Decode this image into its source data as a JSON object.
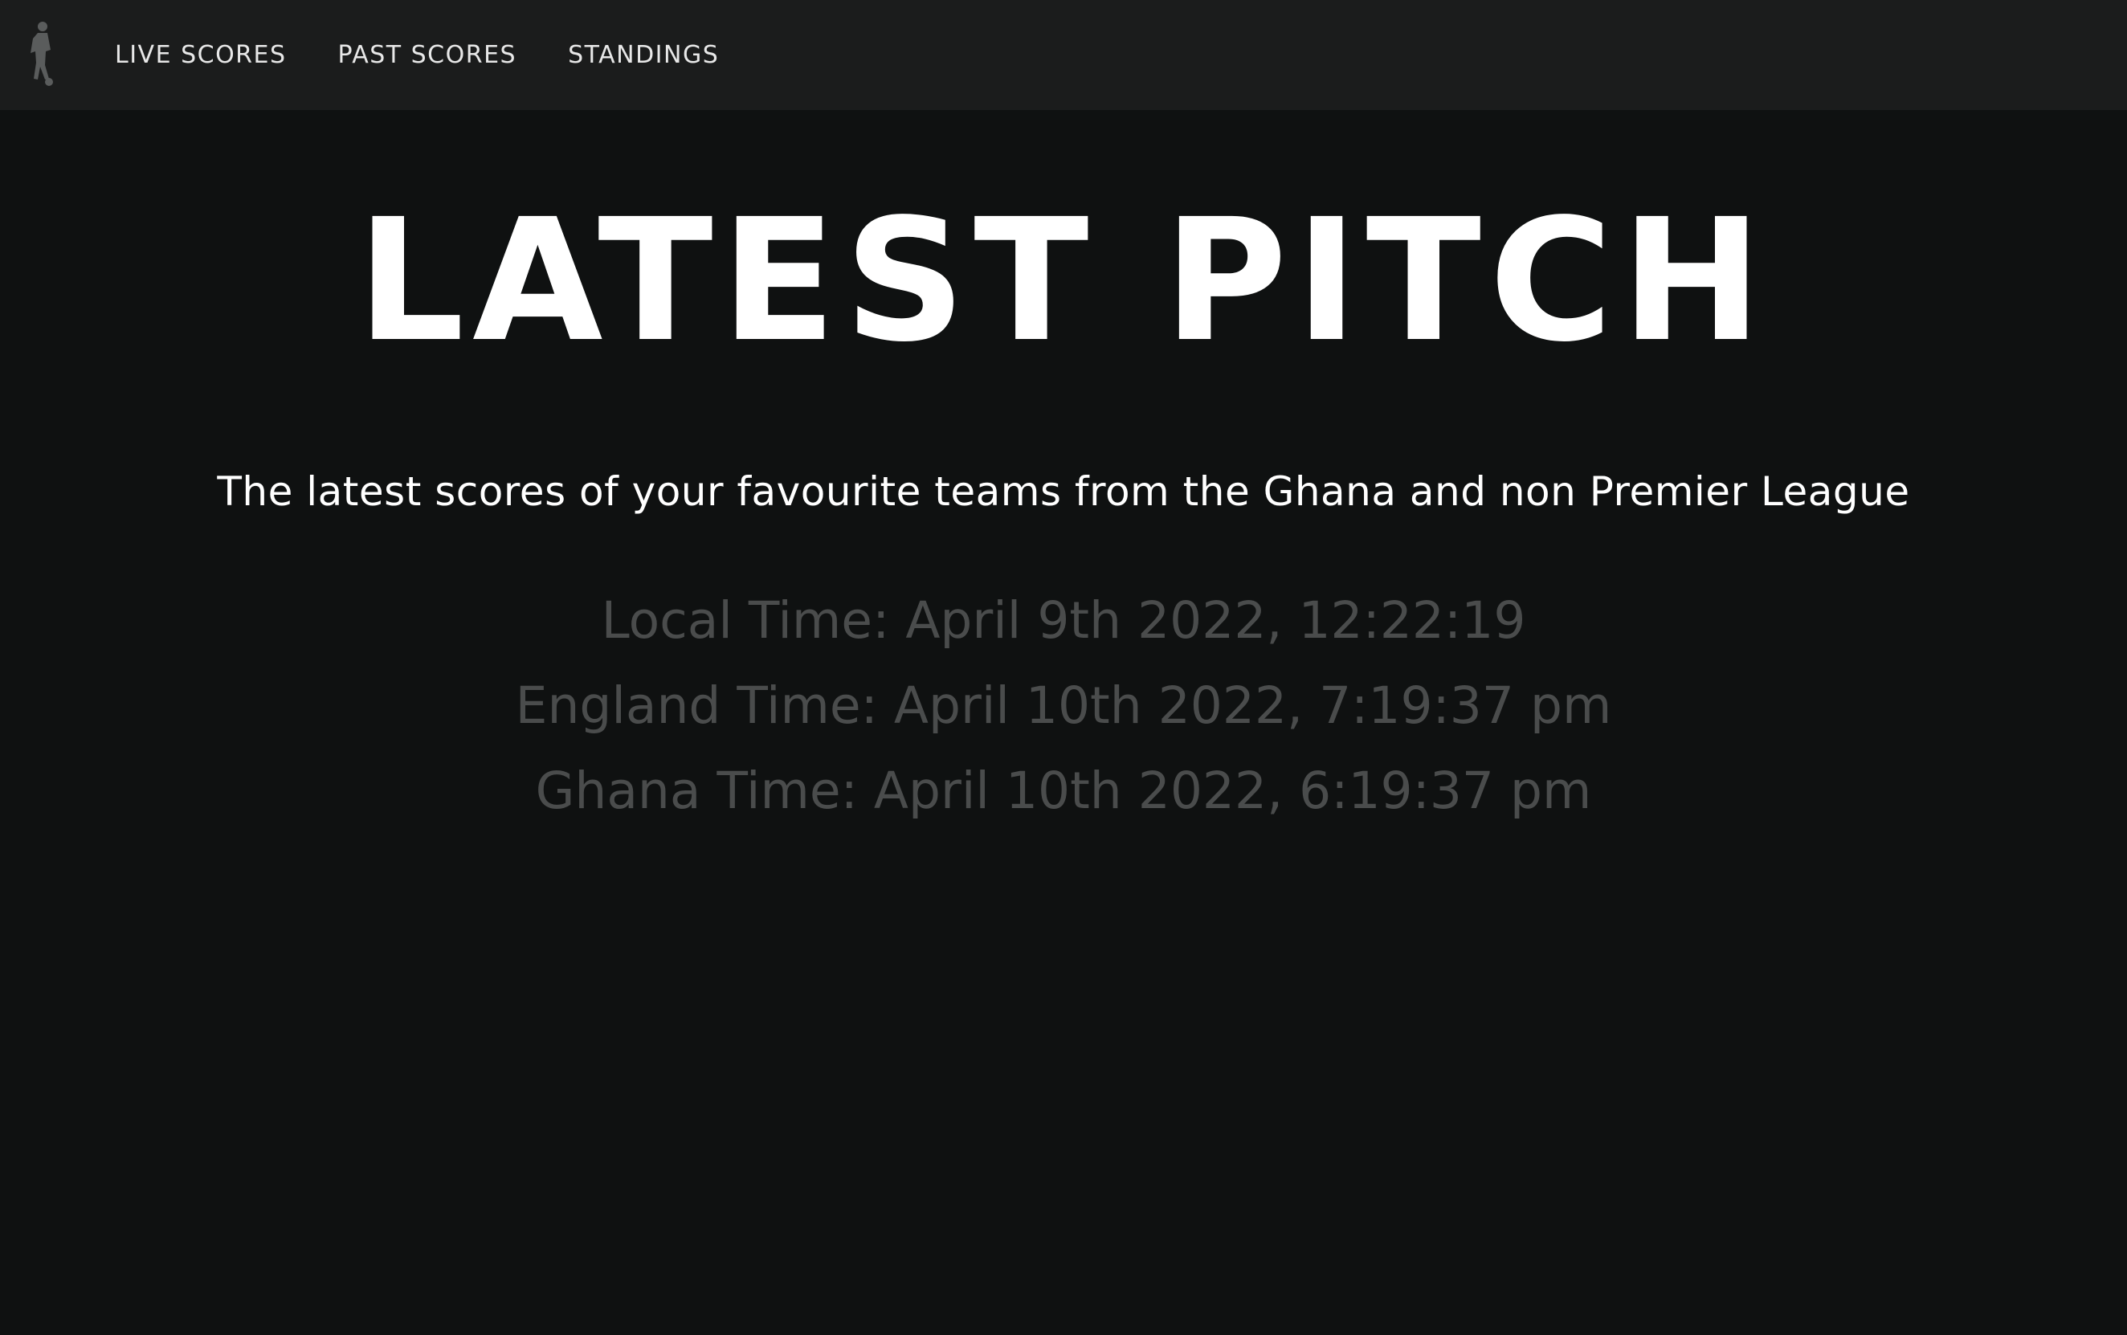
{
  "nav": {
    "logo_icon": "soccer-player-icon",
    "items": [
      {
        "label": "LIVE SCORES"
      },
      {
        "label": "PAST SCORES"
      },
      {
        "label": "STANDINGS"
      }
    ]
  },
  "hero": {
    "title": "LATEST PITCH",
    "subtitle": "The latest scores of your favourite teams from the Ghana and non Premier League"
  },
  "times": {
    "local": "Local Time: April 9th 2022, 12:22:19",
    "england": "England Time: April 10th 2022, 7:19:37 pm",
    "ghana": "Ghana Time: April 10th 2022, 6:19:37 pm"
  },
  "colors": {
    "background": "#0f1111",
    "navbar": "#1b1c1c",
    "text": "#ffffff",
    "muted_text": "#4a4c4c"
  }
}
